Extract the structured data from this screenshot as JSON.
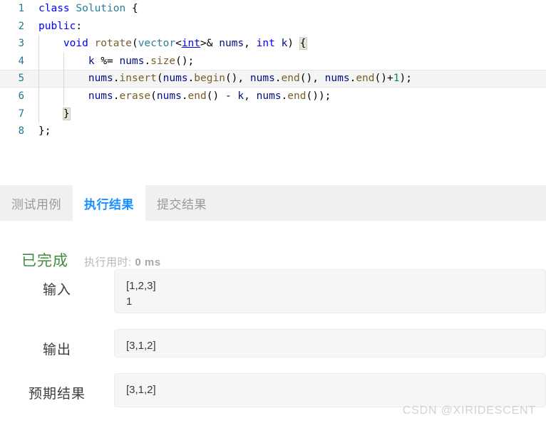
{
  "editor": {
    "language": "cpp",
    "active_line": 5,
    "lines": [
      {
        "num": "1",
        "text": "class Solution {"
      },
      {
        "num": "2",
        "text": "public:"
      },
      {
        "num": "3",
        "text": "    void rotate(vector<int>& nums, int k) {"
      },
      {
        "num": "4",
        "text": "        k %= nums.size();"
      },
      {
        "num": "5",
        "text": "        nums.insert(nums.begin(), nums.end(), nums.end()+1);"
      },
      {
        "num": "6",
        "text": "        nums.erase(nums.end() - k, nums.end());"
      },
      {
        "num": "7",
        "text": "    }"
      },
      {
        "num": "8",
        "text": "};"
      }
    ],
    "colors": {
      "line_number": "#237893",
      "keyword": "#0000ff",
      "type": "#267f99",
      "function": "#795e26",
      "variable": "#001080",
      "number": "#098658",
      "active_line_bg": "#f4f4f4",
      "bracket_match_bg": "#e2e7d7"
    }
  },
  "tabs": [
    {
      "label": "测试用例",
      "active": false
    },
    {
      "label": "执行结果",
      "active": true
    },
    {
      "label": "提交结果",
      "active": false
    }
  ],
  "result": {
    "status": "已完成",
    "status_color": "#3f8e3f",
    "runtime_label": "执行用时:",
    "runtime_value": "0 ms",
    "rows": [
      {
        "label": "输入",
        "value": "[1,2,3]\n1"
      },
      {
        "label": "输出",
        "value": "[3,1,2]"
      },
      {
        "label": "预期结果",
        "value": "[3,1,2]"
      }
    ]
  },
  "watermark": "CSDN @XIRIDESCENT"
}
